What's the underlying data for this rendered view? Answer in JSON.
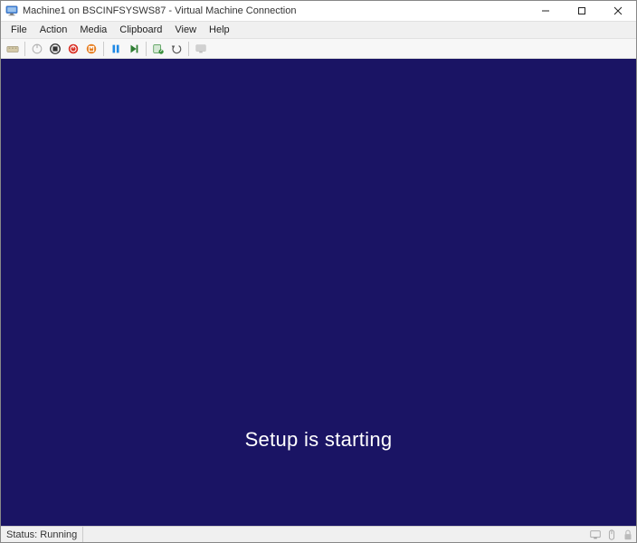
{
  "titlebar": {
    "title": "Machine1 on BSCINFSYSWS87 - Virtual Machine Connection"
  },
  "menubar": {
    "items": [
      "File",
      "Action",
      "Media",
      "Clipboard",
      "View",
      "Help"
    ]
  },
  "vm": {
    "message": "Setup is starting"
  },
  "statusbar": {
    "status": "Status: Running"
  }
}
